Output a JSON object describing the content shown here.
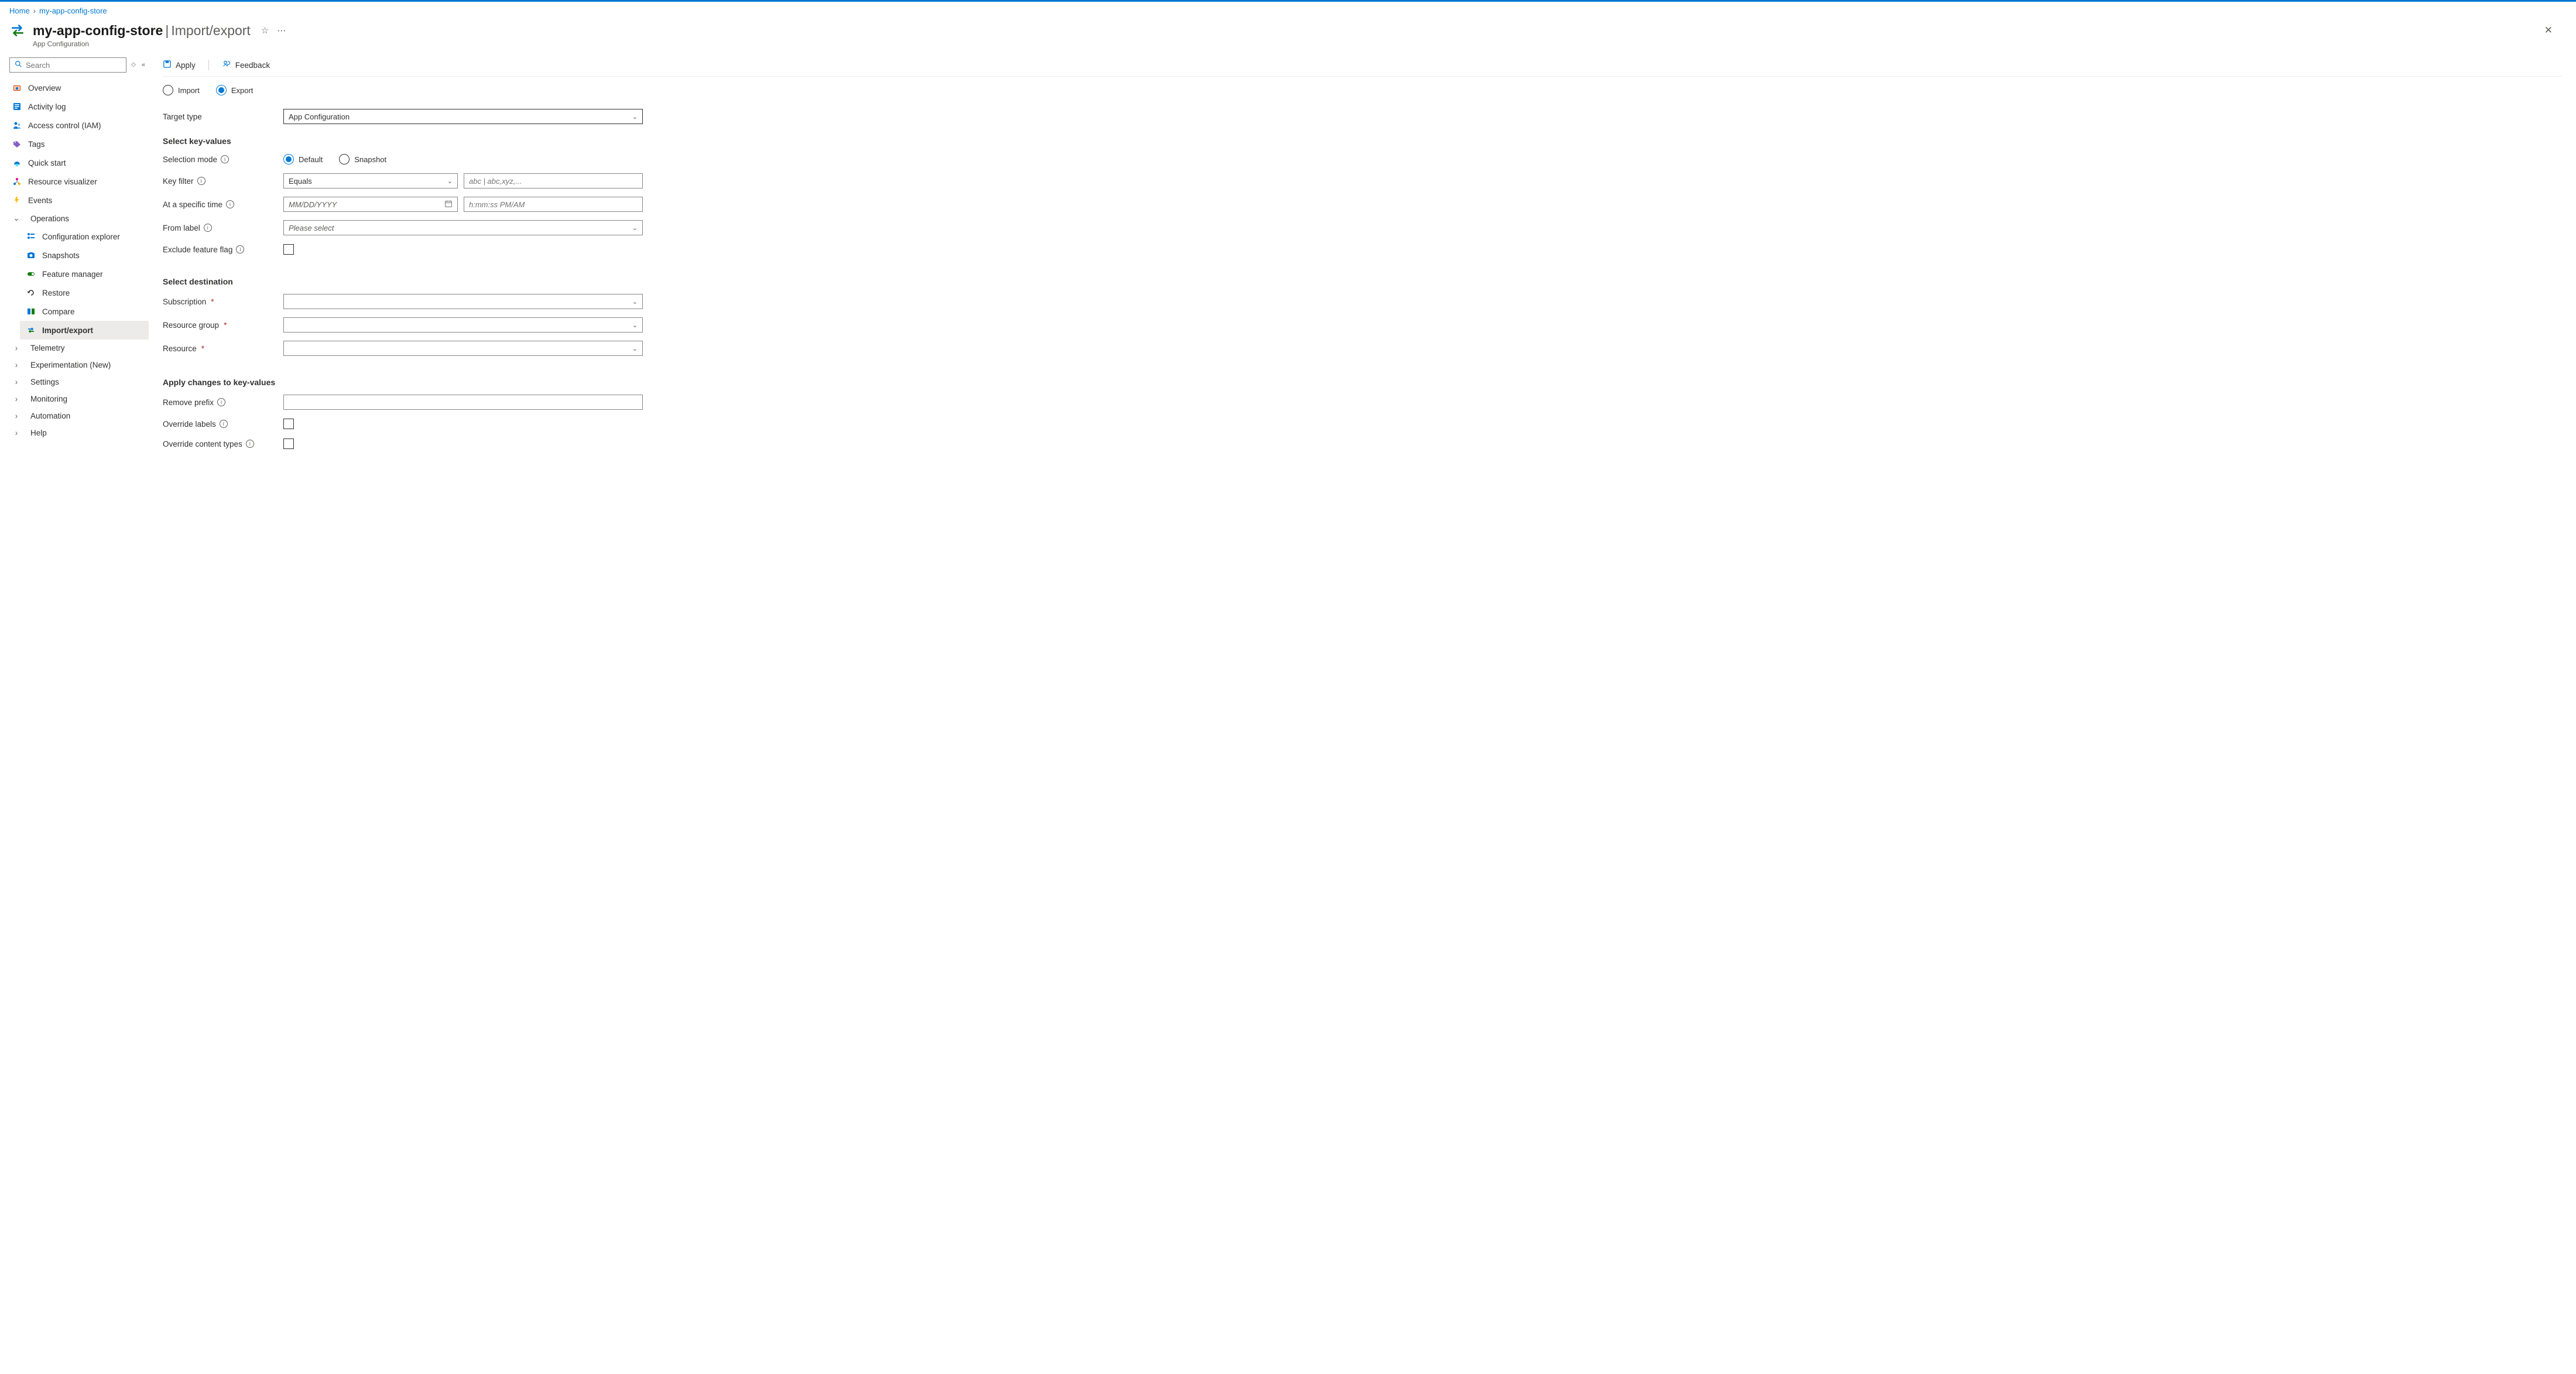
{
  "breadcrumb": {
    "home": "Home",
    "store": "my-app-config-store"
  },
  "header": {
    "title": "my-app-config-store",
    "section": "Import/export",
    "subtitle": "App Configuration"
  },
  "sidebar": {
    "search_placeholder": "Search",
    "items": {
      "overview": "Overview",
      "activity": "Activity log",
      "iam": "Access control (IAM)",
      "tags": "Tags",
      "quickstart": "Quick start",
      "visualizer": "Resource visualizer",
      "events": "Events"
    },
    "operations": {
      "label": "Operations",
      "config_explorer": "Configuration explorer",
      "snapshots": "Snapshots",
      "feature_manager": "Feature manager",
      "restore": "Restore",
      "compare": "Compare",
      "import_export": "Import/export"
    },
    "groups": {
      "telemetry": "Telemetry",
      "experimentation": "Experimentation (New)",
      "settings": "Settings",
      "monitoring": "Monitoring",
      "automation": "Automation",
      "help": "Help"
    }
  },
  "commands": {
    "apply": "Apply",
    "feedback": "Feedback"
  },
  "mode": {
    "import": "Import",
    "export": "Export"
  },
  "form": {
    "target_type_label": "Target type",
    "target_type_value": "App Configuration",
    "section_select": "Select key-values",
    "selection_mode_label": "Selection mode",
    "sel_default": "Default",
    "sel_snapshot": "Snapshot",
    "key_filter_label": "Key filter",
    "key_filter_value": "Equals",
    "key_filter_placeholder": "abc | abc,xyz,...",
    "time_label": "At a specific time",
    "date_placeholder": "MM/DD/YYYY",
    "time_placeholder": "h:mm:ss PM/AM",
    "from_label_label": "From label",
    "from_label_placeholder": "Please select",
    "exclude_ff_label": "Exclude feature flag",
    "section_dest": "Select destination",
    "subscription_label": "Subscription",
    "rg_label": "Resource group",
    "resource_label": "Resource",
    "section_apply": "Apply changes to key-values",
    "remove_prefix_label": "Remove prefix",
    "override_labels_label": "Override labels",
    "override_ct_label": "Override content types"
  }
}
